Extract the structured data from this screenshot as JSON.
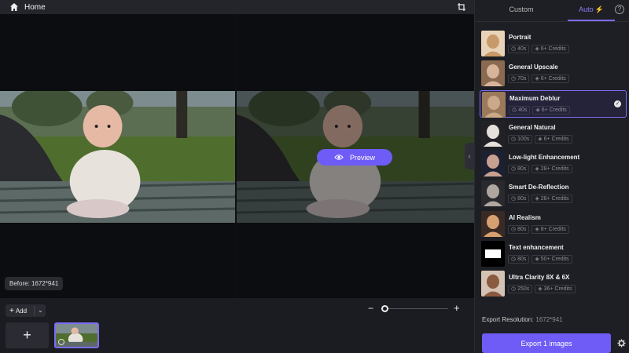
{
  "topbar": {
    "home_label": "Home"
  },
  "canvas": {
    "preview_label": "Preview",
    "before_label": "Before: 1672*941"
  },
  "bottombar": {
    "add_label": "Add",
    "add_tile_symbol": "+",
    "zoom_minus": "−",
    "zoom_plus": "+",
    "zoom_level": 0
  },
  "panel": {
    "tabs": [
      {
        "label": "Custom"
      },
      {
        "label": "Auto"
      }
    ],
    "auto_icon": "⚡",
    "help_symbol": "?",
    "models": [
      {
        "name": "Portrait",
        "time": "40s",
        "credits": "6+ Credits",
        "selected": false
      },
      {
        "name": "General Upscale",
        "time": "70s",
        "credits": "6+ Credits",
        "selected": false
      },
      {
        "name": "Maximum Deblur",
        "time": "40s",
        "credits": "6+ Credits",
        "selected": true
      },
      {
        "name": "General Natural",
        "time": "100s",
        "credits": "6+ Credits",
        "selected": false
      },
      {
        "name": "Low-light Enhancement",
        "time": "80s",
        "credits": "28+ Credits",
        "selected": false
      },
      {
        "name": "Smart De-Reflection",
        "time": "80s",
        "credits": "28+ Credits",
        "selected": false
      },
      {
        "name": "AI Realism",
        "time": "80s",
        "credits": "8+ Credits",
        "selected": false
      },
      {
        "name": "Text enhancement",
        "time": "80s",
        "credits": "50+ Credits",
        "selected": false
      },
      {
        "name": "Ultra Clarity 8X & 6X",
        "time": "250s",
        "credits": "36+ Credits",
        "selected": false
      }
    ],
    "export_resolution_label": "Export Resolution:",
    "export_resolution_value": "1672*941",
    "export_button": "Export 1 images"
  },
  "colors": {
    "accent": "#6f5cf6",
    "accent_border": "#7c6cf7",
    "panel_bg": "#1e1f24",
    "canvas_bg": "#0f1014"
  }
}
